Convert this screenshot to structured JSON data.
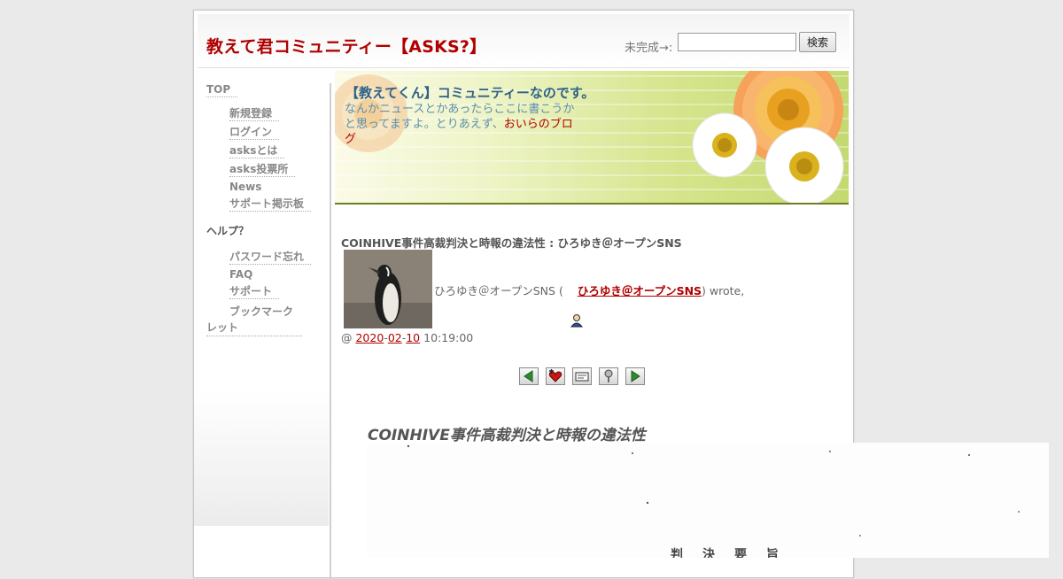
{
  "header": {
    "site_title": "教えて君コミュニティー【ASKS?】",
    "search_label": "未完成→:",
    "search_value": "",
    "search_placeholder": "",
    "search_button": "検索"
  },
  "sidebar": {
    "top_link": "TOP",
    "group1": [
      "新規登録",
      "ログイン",
      "asksとは",
      "asks投票所",
      "News",
      "サポート掲示板"
    ],
    "help_heading": "ヘルプ？",
    "group2": [
      "パスワード忘れ",
      "FAQ",
      "サポート",
      "ブックマークレット"
    ]
  },
  "banner": {
    "title": "【教えてくん】コミュニティーなのです。",
    "text": "なんかニュースとかあったらここに書こうかと思ってますよ。とりあえず、",
    "link": "おいらのブログ"
  },
  "post": {
    "title": "COINHIVE事件高裁判決と時報の違法性 : ひろゆき＠オープンSNS",
    "wrote_prefix": "ひろゆき＠オープンSNS (",
    "author": "ひろゆき＠オープンSNS",
    "wrote_suffix": ") wrote,",
    "date_at": "@ ",
    "date_year": "2020",
    "date_month": "02",
    "date_day": "10",
    "date_time": " 10:19:00"
  },
  "toolbar": {
    "icons": [
      "prev-arrow-icon",
      "add-favorite-icon",
      "memo-icon",
      "tag-icon",
      "next-arrow-icon"
    ]
  },
  "article": {
    "heading": "COINHIVE事件高裁判決と時報の違法性",
    "document_text": "判決要旨"
  },
  "colors": {
    "accent_red": "#b00000",
    "banner_title": "#2f6287",
    "banner_text": "#5b8fb1",
    "banner_rule": "#6d7f1e"
  }
}
